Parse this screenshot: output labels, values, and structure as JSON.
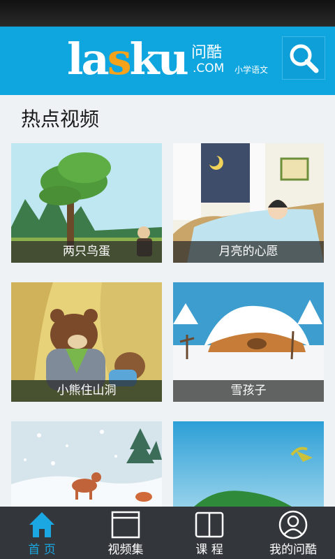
{
  "header": {
    "logo_main_a": "la",
    "logo_main_s": "s",
    "logo_main_b": "ku",
    "logo_cn": "问酷",
    "logo_com": ".COM",
    "logo_sub": "小学语文",
    "search_icon": "search-icon"
  },
  "section": {
    "title": "热点视频"
  },
  "videos": [
    {
      "title": "两只鸟蛋"
    },
    {
      "title": "月亮的心愿"
    },
    {
      "title": "小熊住山洞"
    },
    {
      "title": "雪孩子"
    },
    {
      "title": ""
    },
    {
      "title": ""
    }
  ],
  "tabs": [
    {
      "label": "首 页",
      "icon": "home-icon",
      "active": true
    },
    {
      "label": "视频集",
      "icon": "video-collection-icon",
      "active": false
    },
    {
      "label": "课 程",
      "icon": "book-icon",
      "active": false
    },
    {
      "label": "我的问酷",
      "icon": "user-icon",
      "active": false
    }
  ],
  "colors": {
    "header": "#0fa5df",
    "accent": "#1aa7e2",
    "tabbar": "#33373c",
    "logo_accent": "#f6a21a"
  }
}
